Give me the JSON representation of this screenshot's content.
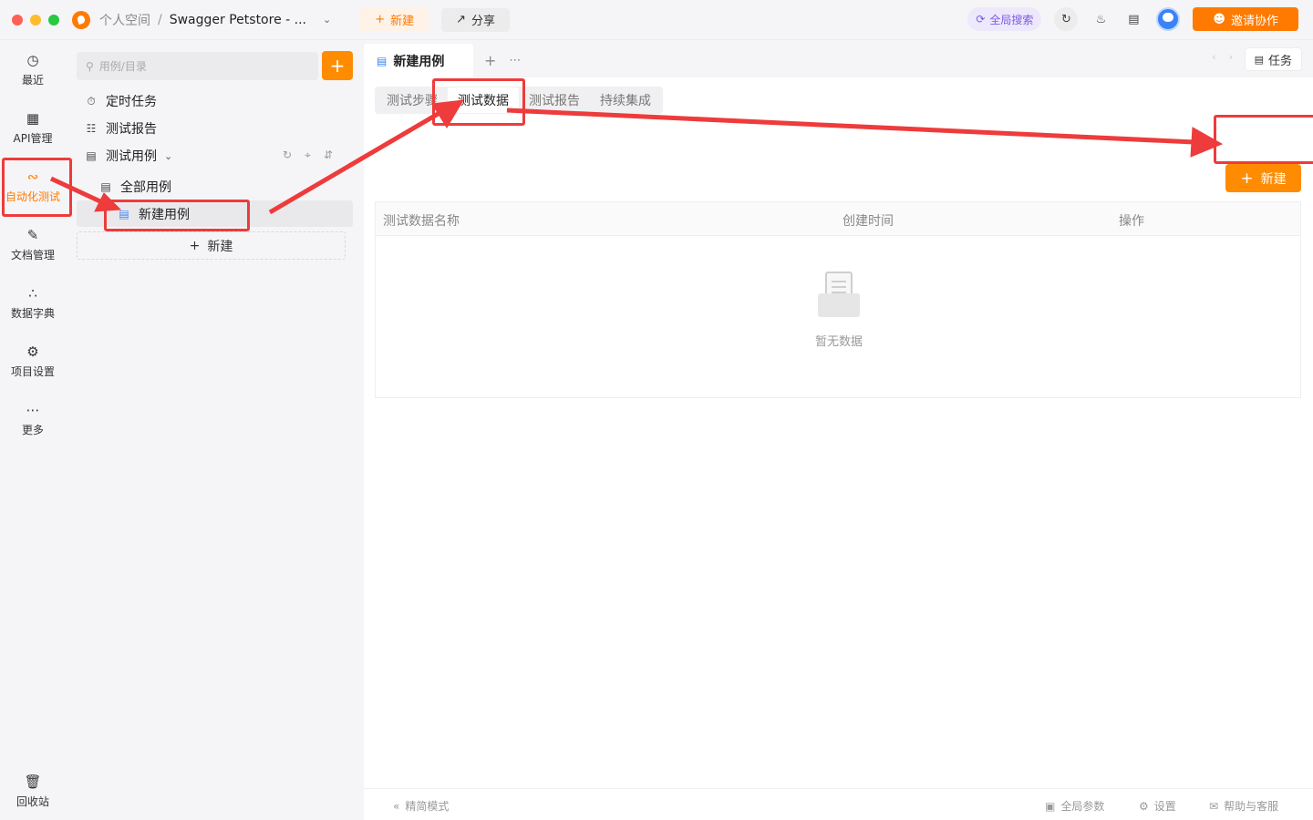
{
  "titlebar": {
    "workspace": "个人空间",
    "separator": "/",
    "project": "Swagger Petstore - ...",
    "new_label": "新建",
    "share_label": "分享",
    "global_search": "全局搜索",
    "invite_label": "邀请协作"
  },
  "rail": {
    "recent": "最近",
    "api": "API管理",
    "autotest": "自动化测试",
    "docs": "文档管理",
    "dictionary": "数据字典",
    "settings": "项目设置",
    "more": "更多",
    "trash": "回收站"
  },
  "sidebar": {
    "search_placeholder": "用例/目录",
    "scheduled": "定时任务",
    "reports": "测试报告",
    "cases": "测试用例",
    "all_cases": "全部用例",
    "new_case": "新建用例",
    "new_label": "新建"
  },
  "tabs": {
    "active": "新建用例",
    "task_label": "任务"
  },
  "subtabs": [
    "测试步骤",
    "测试数据",
    "测试报告",
    "持续集成"
  ],
  "table": {
    "columns": [
      "测试数据名称",
      "创建时间",
      "操作"
    ],
    "empty_text": "暂无数据",
    "new_label": "新建"
  },
  "footer": {
    "simple_mode": "精简模式",
    "global_params": "全局参数",
    "settings": "设置",
    "help": "帮助与客服"
  },
  "colors": {
    "accent": "#ff7a00",
    "annotation": "#ee3b3b"
  }
}
